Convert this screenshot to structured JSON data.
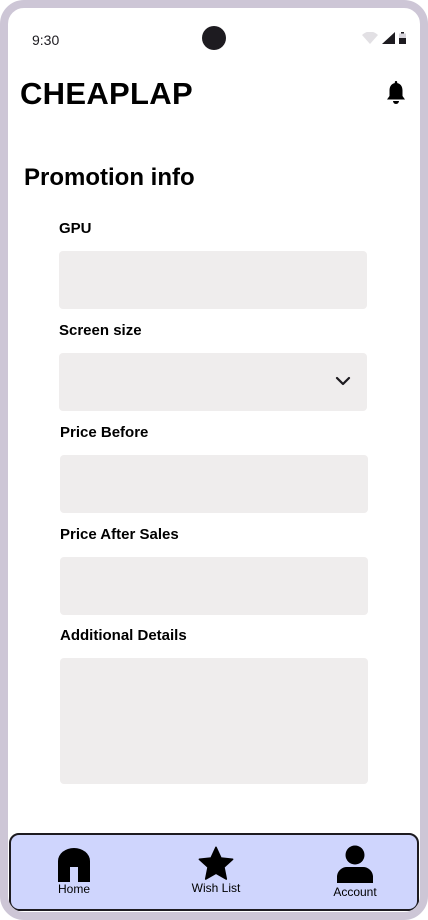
{
  "status_bar": {
    "time": "9:30"
  },
  "header": {
    "app_title": "CHEAPLAP"
  },
  "main": {
    "section_title": "Promotion info",
    "fields": [
      {
        "label": "GPU",
        "value": "",
        "type": "text"
      },
      {
        "label": "Screen size",
        "value": "",
        "type": "select"
      },
      {
        "label": "Price Before",
        "value": "",
        "type": "text"
      },
      {
        "label": "Price After Sales",
        "value": "",
        "type": "text"
      },
      {
        "label": "Additional Details",
        "value": "",
        "type": "textarea"
      }
    ]
  },
  "bottom_nav": {
    "items": [
      {
        "label": "Home",
        "icon": "home-icon"
      },
      {
        "label": "Wish List",
        "icon": "star-icon"
      },
      {
        "label": "Account",
        "icon": "person-icon"
      }
    ]
  },
  "colors": {
    "frame_border": "#cdc6d6",
    "field_background": "#efeded",
    "nav_background": "#cfd5fd",
    "text": "#000000"
  }
}
